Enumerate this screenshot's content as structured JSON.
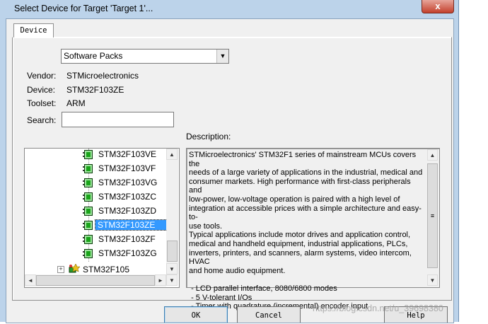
{
  "window": {
    "title": "Select Device for Target 'Target 1'...",
    "close_symbol": "x"
  },
  "tabs": [
    {
      "label": "Device"
    }
  ],
  "source_combo": {
    "value": "Software Packs",
    "arrow": "▼"
  },
  "info": {
    "vendor_label": "Vendor:",
    "vendor_value": "STMicroelectronics",
    "device_label": "Device:",
    "device_value": "STM32F103ZE",
    "toolset_label": "Toolset:",
    "toolset_value": "ARM",
    "search_label": "Search:",
    "search_value": ""
  },
  "tree": {
    "devices": [
      {
        "label": "STM32F103VE",
        "selected": false
      },
      {
        "label": "STM32F103VF",
        "selected": false
      },
      {
        "label": "STM32F103VG",
        "selected": false
      },
      {
        "label": "STM32F103ZC",
        "selected": false
      },
      {
        "label": "STM32F103ZD",
        "selected": false
      },
      {
        "label": "STM32F103ZE",
        "selected": true
      },
      {
        "label": "STM32F103ZF",
        "selected": false
      },
      {
        "label": "STM32F103ZG",
        "selected": false
      }
    ],
    "family": {
      "label": "STM32F105",
      "expander": "+"
    }
  },
  "description": {
    "label": "Description:",
    "text": "STMicroelectronics' STM32F1 series of mainstream MCUs covers the\nneeds of a large variety of applications in the industrial, medical and\nconsumer markets. High performance with first-class peripherals and\nlow-power, low-voltage operation is paired with a high level of\nintegration at accessible prices with a simple architecture and easy-to-\nuse tools.\nTypical applications include motor drives and application control,\nmedical and handheld equipment, industrial applications, PLCs,\ninverters, printers, and scanners, alarm systems, video intercom, HVAC\nand home audio equipment.\n\n - LCD parallel interface, 8080/6800 modes\n - 5 V-tolerant I/Os\n - Timer with quadrature (incremental) encoder input"
  },
  "buttons": {
    "ok": "OK",
    "cancel": "Cancel",
    "help": "Help"
  },
  "watermark": "https://blog.csdn.net/u_39698380",
  "scroll_symbols": {
    "up": "▲",
    "down": "▼",
    "left": "◄",
    "right": "►",
    "grip": "≡"
  }
}
